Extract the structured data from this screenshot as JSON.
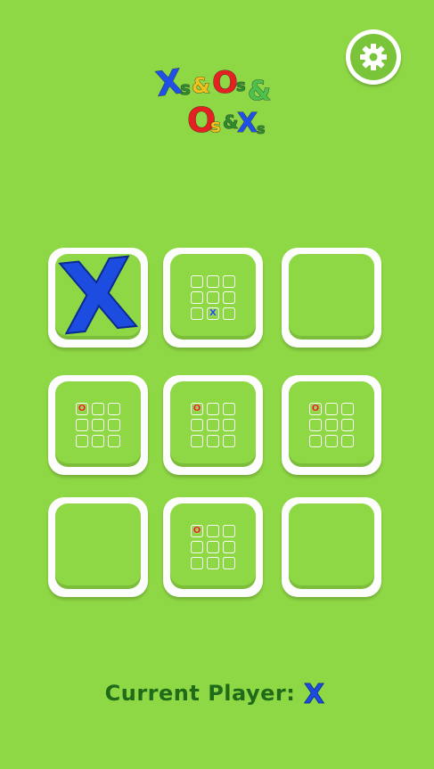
{
  "header": {
    "logo_line1": "Xs&Os&",
    "logo_line2": "Os&Xs",
    "settings_icon": "gear-icon"
  },
  "board": {
    "cells": [
      {
        "state": "X"
      },
      {
        "mini": [
          "",
          "",
          "",
          "",
          "",
          "",
          "",
          "X",
          ""
        ]
      },
      {
        "state": "empty"
      },
      {
        "mini": [
          "O",
          "",
          "",
          "",
          "",
          "",
          "",
          "",
          ""
        ]
      },
      {
        "mini": [
          "O",
          "",
          "",
          "",
          "",
          "",
          "",
          "",
          ""
        ]
      },
      {
        "mini": [
          "O",
          "",
          "",
          "",
          "",
          "",
          "",
          "",
          ""
        ]
      },
      {
        "state": "empty"
      },
      {
        "mini": [
          "O",
          "",
          "",
          "",
          "",
          "",
          "",
          "",
          ""
        ]
      },
      {
        "state": "empty"
      }
    ]
  },
  "status": {
    "label": "Current Player:",
    "player": "X"
  },
  "colors": {
    "background": "#8fd845",
    "x_blue": "#1d4de0",
    "o_red": "#e52020",
    "label_green": "#1f6b1a"
  }
}
